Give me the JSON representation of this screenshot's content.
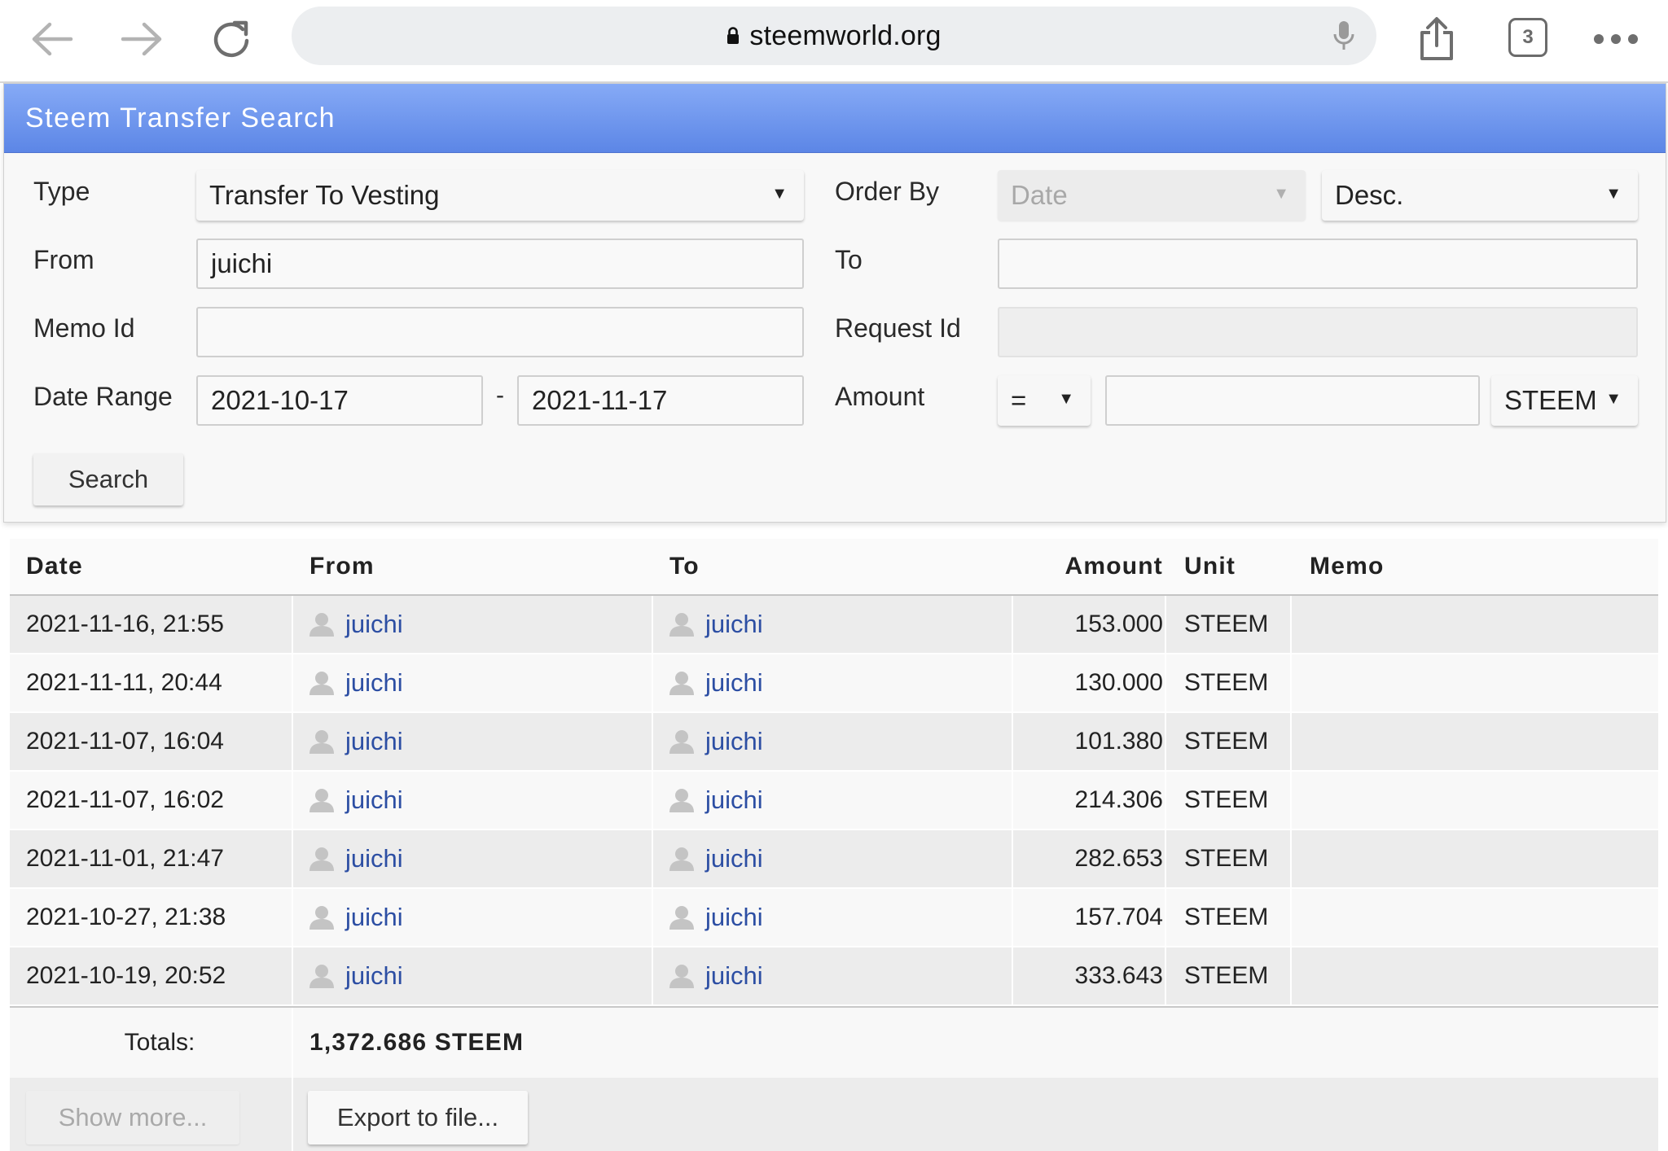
{
  "browser": {
    "url": "steemworld.org",
    "tab_count": "3"
  },
  "panel": {
    "title": "Steem Transfer Search",
    "form": {
      "type_label": "Type",
      "type_value": "Transfer To Vesting",
      "order_by_label": "Order By",
      "order_by_value": "Date",
      "order_dir_value": "Desc.",
      "from_label": "From",
      "from_value": "juichi",
      "to_label": "To",
      "to_value": "",
      "memo_id_label": "Memo Id",
      "memo_id_value": "",
      "request_id_label": "Request Id",
      "request_id_value": "",
      "date_range_label": "Date Range",
      "date_start": "2021-10-17",
      "date_separator": "-",
      "date_end": "2021-11-17",
      "amount_label": "Amount",
      "amount_op": "=",
      "amount_value": "",
      "amount_unit": "STEEM",
      "search_label": "Search"
    }
  },
  "table": {
    "columns": [
      "Date",
      "From",
      "To",
      "Amount",
      "Unit",
      "Memo"
    ],
    "rows": [
      {
        "date": "2021-11-16, 21:55",
        "from": "juichi",
        "to": "juichi",
        "amount": "153.000",
        "unit": "STEEM",
        "memo": ""
      },
      {
        "date": "2021-11-11, 20:44",
        "from": "juichi",
        "to": "juichi",
        "amount": "130.000",
        "unit": "STEEM",
        "memo": ""
      },
      {
        "date": "2021-11-07, 16:04",
        "from": "juichi",
        "to": "juichi",
        "amount": "101.380",
        "unit": "STEEM",
        "memo": ""
      },
      {
        "date": "2021-11-07, 16:02",
        "from": "juichi",
        "to": "juichi",
        "amount": "214.306",
        "unit": "STEEM",
        "memo": ""
      },
      {
        "date": "2021-11-01, 21:47",
        "from": "juichi",
        "to": "juichi",
        "amount": "282.653",
        "unit": "STEEM",
        "memo": ""
      },
      {
        "date": "2021-10-27, 21:38",
        "from": "juichi",
        "to": "juichi",
        "amount": "157.704",
        "unit": "STEEM",
        "memo": ""
      },
      {
        "date": "2021-10-19, 20:52",
        "from": "juichi",
        "to": "juichi",
        "amount": "333.643",
        "unit": "STEEM",
        "memo": ""
      }
    ],
    "totals_label": "Totals:",
    "totals_value": "1,372.686 STEEM",
    "show_more_label": "Show more...",
    "export_label": "Export to file..."
  },
  "icons": {
    "back": "arrow-left-icon",
    "forward": "arrow-right-icon",
    "reload": "reload-icon",
    "lock": "lock-icon",
    "mic": "microphone-icon",
    "share": "share-icon",
    "tabs": "tabs-icon",
    "more": "more-icon",
    "user": "user-icon"
  },
  "colors": {
    "header_gradient_top": "#86aaf6",
    "header_gradient_bottom": "#5c86e6",
    "link": "#2c4ea3"
  }
}
